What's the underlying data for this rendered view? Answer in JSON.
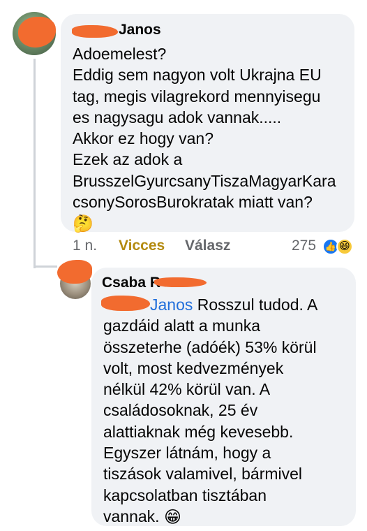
{
  "main_comment": {
    "author_visible": "Janos",
    "lines": [
      "Adoemelest?",
      "Eddig sem nagyon volt Ukrajna EU",
      "tag, megis vilagrekord mennyisegu",
      "es nagysagu adok vannak.....",
      "Akkor ez hogy van?",
      "Ezek az adok a",
      "BrusszelGyurcsanyTiszaMagyarKara",
      "csonySorosBurokratak miatt van?"
    ],
    "trailing_emoji": "🤔",
    "time": "1 n.",
    "reaction_label": "Vicces",
    "reply_label": "Válasz",
    "reaction_count": "275",
    "reaction_icons": [
      "like-icon",
      "haha-icon"
    ]
  },
  "reply_comment": {
    "author_visible": "Csaba R",
    "mention": "Janos",
    "first_line_rest": " Rosszul tudod. A",
    "lines": [
      "gazdáid alatt a munka",
      "összeterhe (adóék) 53% körül",
      "volt, most kedvezmények",
      "nélkül 42% körül van. A",
      "családosoknak, 25 év",
      "alattiaknak még kevesebb.",
      "Egyszer látnám, hogy a",
      "tiszások valamivel, bármivel",
      "kapcsolatban tisztában"
    ],
    "last_line": "vannak.",
    "trailing_emoji": "😁"
  },
  "colors": {
    "bubble": "#f0f2f5",
    "mention": "#216fdb",
    "vicces": "#b38a0f",
    "meta": "#65676b",
    "redaction": "#f26b2f"
  }
}
